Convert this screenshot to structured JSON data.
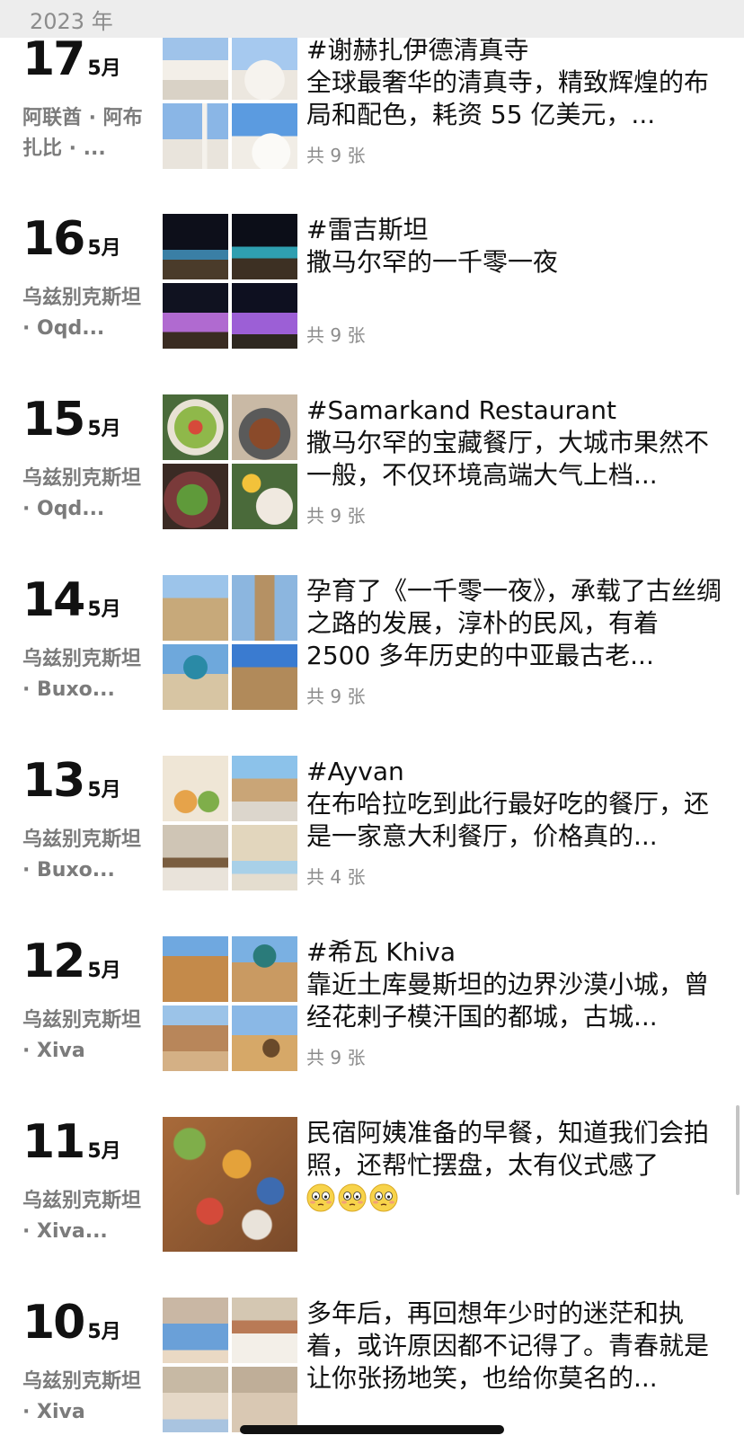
{
  "header": {
    "year": "2023 年"
  },
  "posts": [
    {
      "day": "17",
      "month": "5月",
      "location": "阿联酋 · 阿布扎比 · ...",
      "tag": "#谢赫扎伊德清真寺",
      "desc": "全球最奢华的清真寺，精致辉煌的布局和配色，耗资 55 亿美元，...",
      "count": "共 9 张",
      "thumbs": [
        "white-mosque",
        "white-mosque-dome",
        "white-mosque-minaret",
        "white-mosque-courtyard"
      ]
    },
    {
      "day": "16",
      "month": "5月",
      "location": "乌兹别克斯坦 · Oqd...",
      "tag": "#雷吉斯坦",
      "desc": "撒马尔罕的一千零一夜",
      "count": "共 9 张",
      "thumbs": [
        "night-square-1",
        "night-square-2",
        "night-square-3",
        "night-square-4"
      ]
    },
    {
      "day": "15",
      "month": "5月",
      "location": "乌兹别克斯坦 · Oqd...",
      "tag": "#Samarkand Restaurant",
      "desc": "撒马尔罕的宝藏餐厅，大城市果然不一般，不仅环境高端大气上档...",
      "count": "共 9 张",
      "thumbs": [
        "salad-plate",
        "grilled-meat",
        "green-salad",
        "drink-and-dish"
      ]
    },
    {
      "day": "14",
      "month": "5月",
      "location": "乌兹别克斯坦 · Buxo...",
      "tag": "",
      "desc": "孕育了《一千零一夜》，承载了古丝绸之路的发展，淳朴的民风，有着 2500 多年历史的中亚最古老...",
      "count": "共 9 张",
      "thumbs": [
        "old-walls",
        "minaret-tower",
        "blue-dome",
        "mausoleum"
      ]
    },
    {
      "day": "13",
      "month": "5月",
      "location": "乌兹别克斯坦 · Buxo...",
      "tag": "#Ayvan",
      "desc": "在布哈拉吃到此行最好吃的餐厅，还是一家意大利餐厅，价格真的...",
      "count": "共 4 张",
      "thumbs": [
        "food-board",
        "courtyard-terrace",
        "dining-hall",
        "ornate-room"
      ]
    },
    {
      "day": "12",
      "month": "5月",
      "location": "乌兹别克斯坦 · Xiva",
      "tag": "#希瓦 Khiva",
      "desc": "靠近土库曼斯坦的边界沙漠小城，曾经花剌子模汗国的都城，古城...",
      "count": "共 9 张",
      "thumbs": [
        "city-walls",
        "green-dome",
        "sand-street",
        "camel"
      ]
    },
    {
      "day": "11",
      "month": "5月",
      "location": "乌兹别克斯坦 · Xiva...",
      "tag": "",
      "desc": "民宿阿姨准备的早餐，知道我们会拍照，还帮忙摆盘，太有仪式感了",
      "emoji_count": 3,
      "count": "",
      "thumbs": [
        "breakfast-table"
      ]
    },
    {
      "day": "10",
      "month": "5月",
      "location": "乌兹别克斯坦 · Xiva",
      "tag": "",
      "desc": "多年后，再回想年少时的迷茫和执着，或许原因都不记得了。青春就是让你张扬地笑，也给你莫名的...",
      "count": "",
      "thumbs": [
        "kids-1",
        "kids-2",
        "kids-3",
        "kids-4"
      ]
    }
  ],
  "colors": {
    "header_bg": "#ededed",
    "secondary_text": "#7b7b7b",
    "count_text": "#8c8c8c"
  }
}
